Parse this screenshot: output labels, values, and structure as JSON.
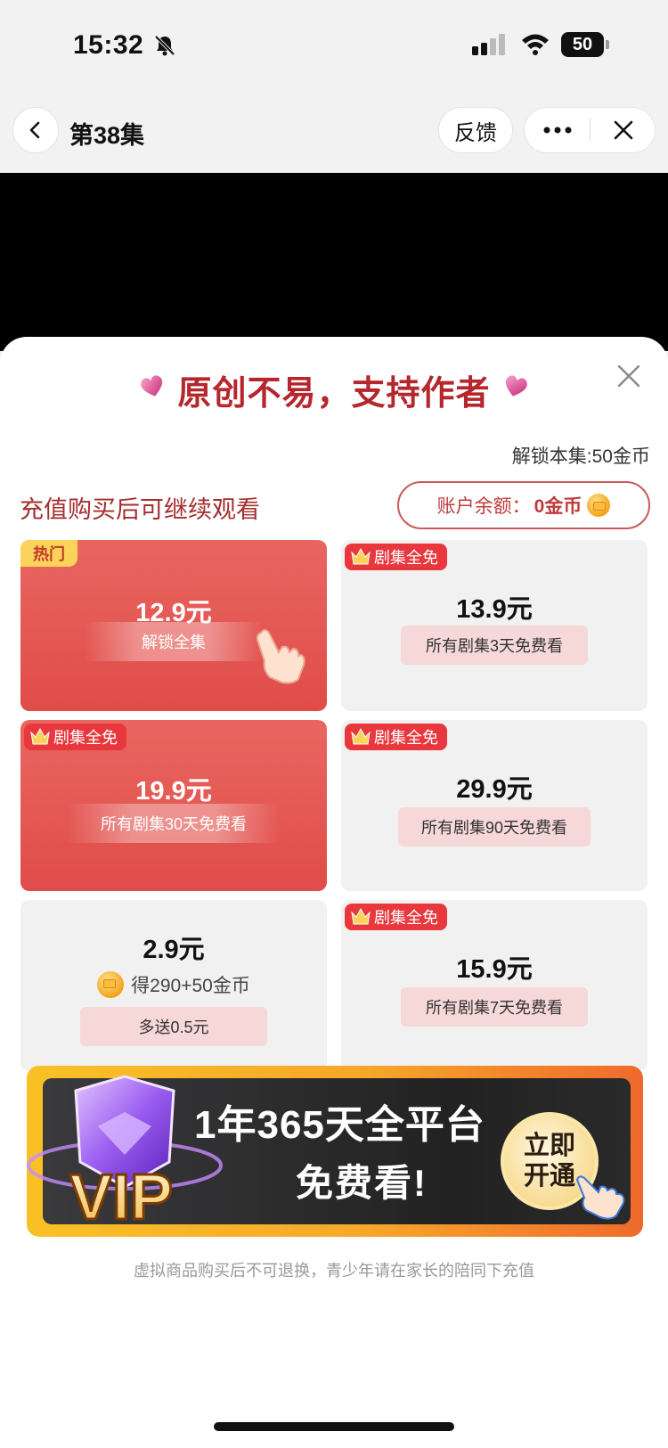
{
  "status_bar": {
    "time": "15:32",
    "battery": "50"
  },
  "nav": {
    "title": "第38集",
    "feedback_label": "反馈"
  },
  "sheet": {
    "title": "原创不易，支持作者",
    "unlock_price": "解锁本集:50金币",
    "subtitle": "充值购买后可继续观看",
    "balance_label": "账户余额：",
    "balance_value": "0金币"
  },
  "cards": [
    {
      "tag": "热门",
      "price": "12.9元",
      "desc": "解锁全集",
      "style": "red"
    },
    {
      "tag": "剧集全免",
      "price": "13.9元",
      "desc": "所有剧集3天免费看",
      "style": "grey"
    },
    {
      "tag": "剧集全免",
      "price": "19.9元",
      "desc": "所有剧集30天免费看",
      "style": "red"
    },
    {
      "tag": "剧集全免",
      "price": "29.9元",
      "desc": "所有剧集90天免费看",
      "style": "grey"
    },
    {
      "tag": "",
      "price": "2.9元",
      "coins": "得290+50金币",
      "desc": "多送0.5元",
      "style": "grey"
    },
    {
      "tag": "剧集全免",
      "price": "15.9元",
      "desc": "所有剧集7天免费看",
      "style": "grey"
    }
  ],
  "vip": {
    "badge": "VIP",
    "line1": "1年365天全平台",
    "line2": "免费看!",
    "button_line1": "立即",
    "button_line2": "开通"
  },
  "disclaimer": "虚拟商品购买后不可退换，青少年请在家长的陪同下充值",
  "colors": {
    "accent_red": "#e04c49",
    "title_red": "#b5262d",
    "tag_yellow": "#fbd35a",
    "vip_orange": "#f6a72a"
  }
}
